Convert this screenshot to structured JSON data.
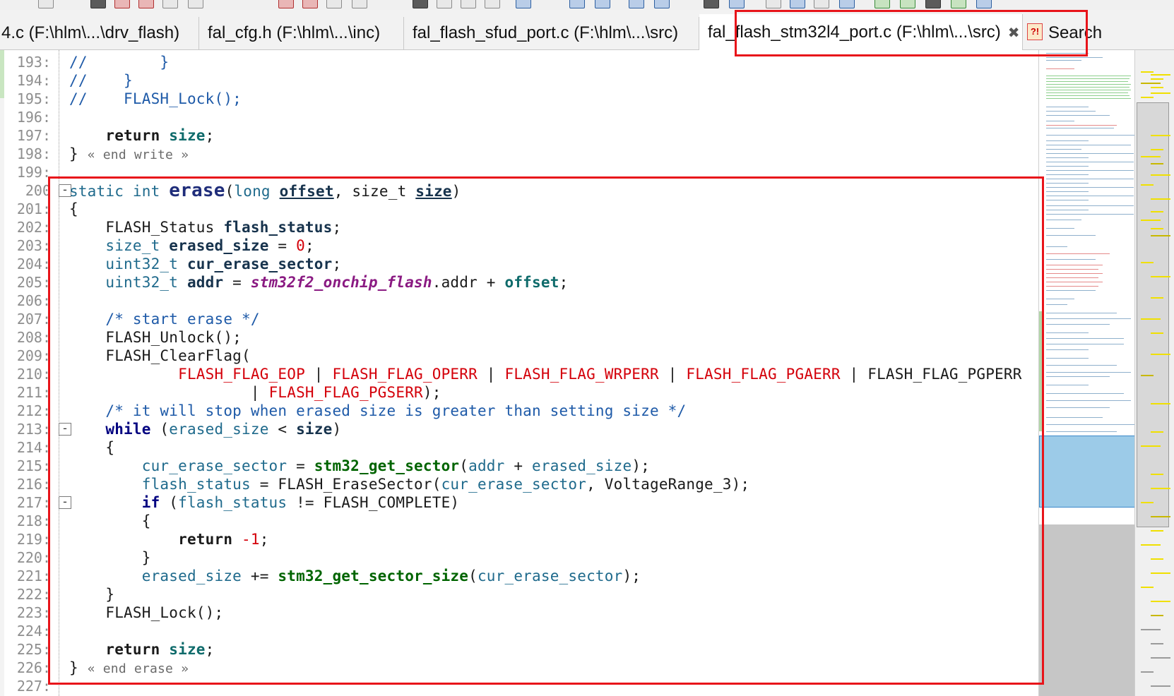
{
  "tabs": [
    {
      "label": "4.c (F:\\hlm\\...\\drv_flash)",
      "active": false
    },
    {
      "label": "fal_cfg.h (F:\\hlm\\...\\inc)",
      "active": false
    },
    {
      "label": "fal_flash_sfud_port.c (F:\\hlm\\...\\src)",
      "active": false
    },
    {
      "label": "fal_flash_stm32l4_port.c (F:\\hlm\\...\\src)",
      "active": true,
      "close": "✖"
    },
    {
      "label": "Search",
      "active": false
    }
  ],
  "search_icon_glyph": "?!",
  "colors": {
    "annotation": "#e8141a",
    "keyword": "#000080",
    "macro": "#d4000a",
    "comment": "#1e5aa8",
    "call": "#006400"
  },
  "code": {
    "lines": [
      {
        "n": "193:",
        "text": "//        }"
      },
      {
        "n": "194:",
        "text": "//    }"
      },
      {
        "n": "195:",
        "text": "//    FLASH_Lock();"
      },
      {
        "n": "196:",
        "text": ""
      },
      {
        "n": "197:",
        "text": "    return size;"
      },
      {
        "n": "198:",
        "text": "} « end write »"
      },
      {
        "n": "199:",
        "text": ""
      },
      {
        "n": "200",
        "text": "static int erase(long offset, size_t size)"
      },
      {
        "n": "201:",
        "text": "{"
      },
      {
        "n": "202:",
        "text": "    FLASH_Status flash_status;"
      },
      {
        "n": "203:",
        "text": "    size_t erased_size = 0;"
      },
      {
        "n": "204:",
        "text": "    uint32_t cur_erase_sector;"
      },
      {
        "n": "205:",
        "text": "    uint32_t addr = stm32f2_onchip_flash.addr + offset;"
      },
      {
        "n": "206:",
        "text": ""
      },
      {
        "n": "207:",
        "text": "    /* start erase */"
      },
      {
        "n": "208:",
        "text": "    FLASH_Unlock();"
      },
      {
        "n": "209:",
        "text": "    FLASH_ClearFlag("
      },
      {
        "n": "210:",
        "text": "            FLASH_FLAG_EOP | FLASH_FLAG_OPERR | FLASH_FLAG_WRPERR | FLASH_FLAG_PGAERR | FLASH_FLAG_PGPERR"
      },
      {
        "n": "211:",
        "text": "                    | FLASH_FLAG_PGSERR);"
      },
      {
        "n": "212:",
        "text": "    /* it will stop when erased size is greater than setting size */"
      },
      {
        "n": "213:",
        "text": "    while (erased_size < size)"
      },
      {
        "n": "214:",
        "text": "    {"
      },
      {
        "n": "215:",
        "text": "        cur_erase_sector = stm32_get_sector(addr + erased_size);"
      },
      {
        "n": "216:",
        "text": "        flash_status = FLASH_EraseSector(cur_erase_sector, VoltageRange_3);"
      },
      {
        "n": "217:",
        "text": "        if (flash_status != FLASH_COMPLETE)"
      },
      {
        "n": "218:",
        "text": "        {"
      },
      {
        "n": "219:",
        "text": "            return -1;"
      },
      {
        "n": "220:",
        "text": "        }"
      },
      {
        "n": "221:",
        "text": "        erased_size += stm32_get_sector_size(cur_erase_sector);"
      },
      {
        "n": "222:",
        "text": "    }"
      },
      {
        "n": "223:",
        "text": "    FLASH_Lock();"
      },
      {
        "n": "224:",
        "text": ""
      },
      {
        "n": "225:",
        "text": "    return size;"
      },
      {
        "n": "226:",
        "text": "} « end erase »"
      },
      {
        "n": "227:",
        "text": ""
      }
    ]
  }
}
